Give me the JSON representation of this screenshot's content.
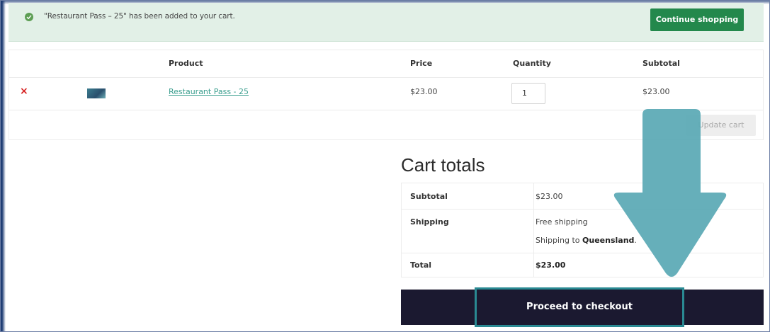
{
  "notice": {
    "message": "\"Restaurant Pass – 25\" has been added to your cart.",
    "continue_label": "Continue shopping"
  },
  "cart": {
    "columns": [
      "Product",
      "Price",
      "Quantity",
      "Subtotal"
    ],
    "items": [
      {
        "remove_label": "×",
        "product_name": "Restaurant Pass - 25",
        "price": "$23.00",
        "quantity": "1",
        "subtotal": "$23.00"
      }
    ],
    "update_label": "Update cart"
  },
  "totals": {
    "title": "Cart totals",
    "subtotal_label": "Subtotal",
    "subtotal_value": "$23.00",
    "shipping_label": "Shipping",
    "shipping_method": "Free shipping",
    "shipping_to_prefix": "Shipping to",
    "shipping_region": "Queensland",
    "shipping_to_suffix": ".",
    "total_label": "Total",
    "total_value": "$23.00"
  },
  "checkout_label": "Proceed to checkout",
  "colors": {
    "notice_bg": "#e2f0e7",
    "continue_button": "#23884c",
    "remove": "#d62121",
    "link": "#3a9e8e",
    "checkout_button": "#1b1930",
    "annotation": "#5aa9b5"
  }
}
